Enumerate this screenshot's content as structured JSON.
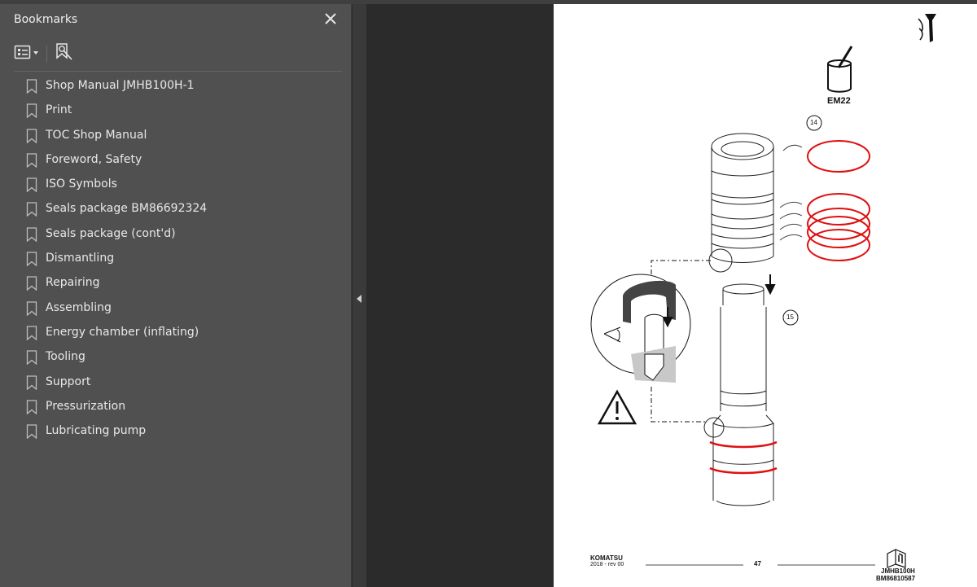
{
  "sidebar": {
    "title": "Bookmarks",
    "items": [
      {
        "label": "Shop Manual JMHB100H-1"
      },
      {
        "label": "Print"
      },
      {
        "label": "TOC Shop Manual"
      },
      {
        "label": "Foreword, Safety"
      },
      {
        "label": "ISO Symbols"
      },
      {
        "label": "Seals package BM86692324"
      },
      {
        "label": "Seals package (cont'd)"
      },
      {
        "label": "Dismantling"
      },
      {
        "label": "Repairing"
      },
      {
        "label": "Assembling"
      },
      {
        "label": "Energy chamber (inflating)"
      },
      {
        "label": "Tooling"
      },
      {
        "label": "Support"
      },
      {
        "label": "Pressurization"
      },
      {
        "label": "Lubricating pump"
      }
    ]
  },
  "page": {
    "product_code": "EM22",
    "callout_a": "14",
    "callout_b": "15",
    "brand": "KOMATSU",
    "year_rev": "2018 -  rev 00",
    "page_number": "47",
    "model": "JMHB100H",
    "doc_number": "BM86810587"
  },
  "colors": {
    "seal_red": "#e01010",
    "sidebar_bg": "#505050",
    "viewer_bg": "#2b2b2b"
  }
}
